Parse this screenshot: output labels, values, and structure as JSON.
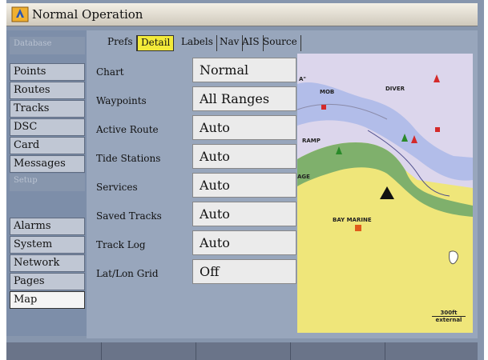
{
  "title": "Normal Operation",
  "sidebar": {
    "items": [
      {
        "label": "Database",
        "disabled": true
      },
      {
        "label": "Points"
      },
      {
        "label": "Routes"
      },
      {
        "label": "Tracks"
      },
      {
        "label": "DSC"
      },
      {
        "label": "Card"
      },
      {
        "label": "Messages"
      },
      {
        "label": "Setup",
        "disabled": true
      },
      {
        "label": "Alarms"
      },
      {
        "label": "System"
      },
      {
        "label": "Network"
      },
      {
        "label": "Pages"
      },
      {
        "label": "Map",
        "selected": true
      }
    ]
  },
  "tabs": [
    {
      "label": "Prefs"
    },
    {
      "label": "Detail",
      "active": true
    },
    {
      "label": "Labels"
    },
    {
      "label": "Nav"
    },
    {
      "label": "AIS"
    },
    {
      "label": "Source"
    }
  ],
  "settings": [
    {
      "label": "Chart",
      "value": "Normal"
    },
    {
      "label": "Waypoints",
      "value": "All Ranges"
    },
    {
      "label": "Active Route",
      "value": "Auto"
    },
    {
      "label": "Tide Stations",
      "value": "Auto"
    },
    {
      "label": "Services",
      "value": "Auto"
    },
    {
      "label": "Saved Tracks",
      "value": "Auto"
    },
    {
      "label": "Track Log",
      "value": "Auto"
    },
    {
      "label": "Lat/Lon Grid",
      "value": "Off"
    }
  ],
  "map": {
    "labels": {
      "a": "A\"",
      "diver": "DIVER",
      "mob": "MOB",
      "ramp": "RAMP",
      "age": "AGE",
      "bay_marine": "BAY MARINE"
    },
    "scale": "300ft",
    "source": "external"
  },
  "colors": {
    "title_bg": "#e9e4d8",
    "sidebar_bg": "#7d8ea9",
    "panel_bg": "#98a6bc",
    "tab_active": "#f3ea3a",
    "value_bg": "#ebebeb",
    "water_deep": "#dcd6ec",
    "water_shallow": "#a8b6e8",
    "land": "#efe67a",
    "shore_green": "#7fb06c"
  }
}
